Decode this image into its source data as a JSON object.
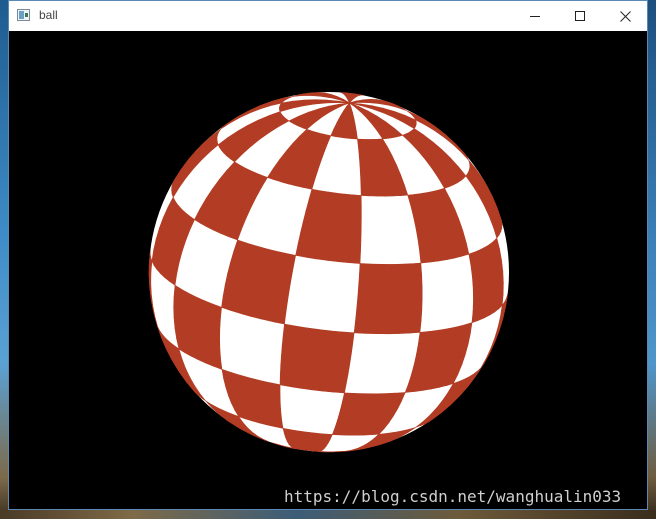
{
  "window": {
    "title": "ball",
    "icon": "app-window-icon",
    "controls": {
      "minimize_icon": "minimize-icon",
      "maximize_icon": "maximize-icon",
      "close_icon": "close-icon"
    }
  },
  "ball": {
    "red_color": "#b23c24",
    "white_color": "#ffffff",
    "background_color": "#000000"
  },
  "watermark": {
    "text": "https://blog.csdn.net/wanghualin033"
  }
}
